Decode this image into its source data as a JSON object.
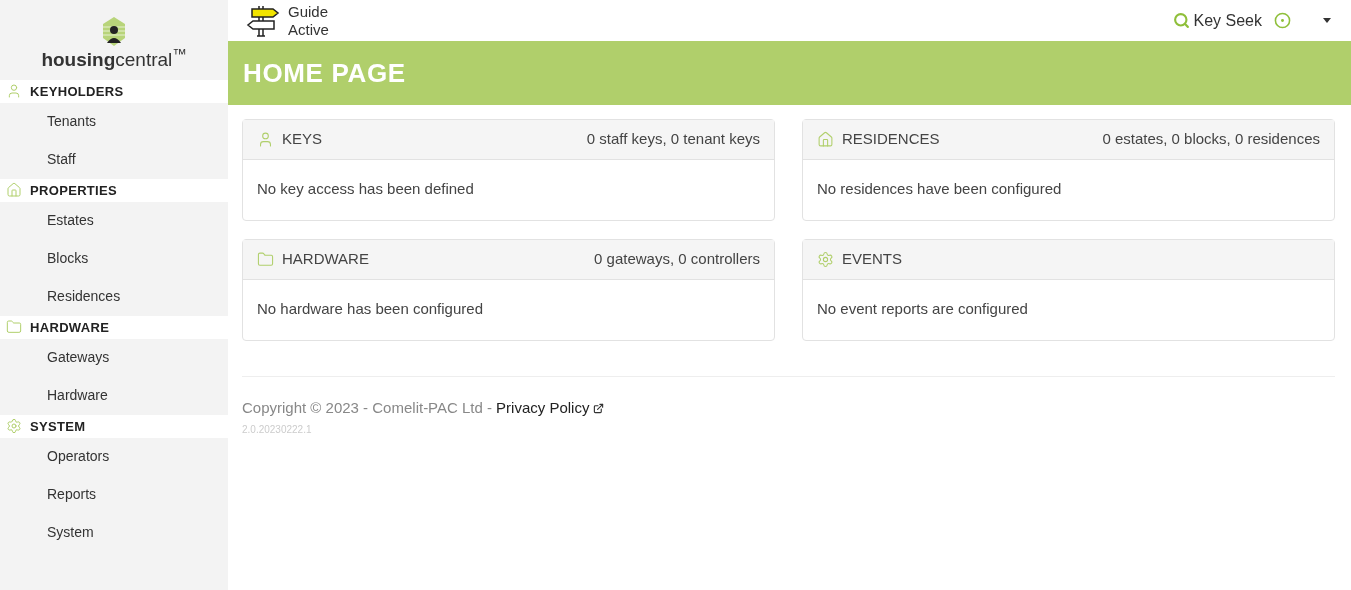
{
  "logo": {
    "text": "**housing**central$^{™}$"
  },
  "sidebar": {
    "sections": [
      {
        "title": "KEYHOLDERS",
        "kind": "keyholders",
        "items": [
          "Tenants",
          "Staff"
        ]
      },
      {
        "title": "PROPERTIES",
        "kind": "properties",
        "items": [
          "Estates",
          "Blocks",
          "Residences"
        ]
      },
      {
        "title": "HARDWARE",
        "kind": "hardware",
        "items": [
          "Gateways",
          "Hardware"
        ]
      },
      {
        "title": "SYSTEM",
        "kind": "system",
        "items": [
          "Operators",
          "Reports",
          "System"
        ]
      }
    ]
  },
  "guide": {
    "line_1": "Guide",
    "line_2": "Active"
  },
  "user_menu": {
    "label": "Key Seek"
  },
  "page_title": "HOME PAGE",
  "cards": [
    {
      "title": "KEYS",
      "kind": "keyholders",
      "summary": "0 staff keys, 0 tenant keys",
      "message": "No key access has been defined"
    },
    {
      "title": "RESIDENCES",
      "kind": "properties",
      "summary": "0 estates, 0 blocks, 0 residences",
      "message": "No residences have been configured"
    },
    {
      "title": "HARDWARE",
      "kind": "hardware",
      "summary": "0 gateways, 0 controllers",
      "message": "No hardware has been configured"
    },
    {
      "title": "EVENTS",
      "kind": "system",
      "message": "No event reports are configured"
    }
  ],
  "footer": {
    "copyright": "Copyright © 2023 - Comelit-PAC Ltd -",
    "link": "Privacy Policy",
    "version": "2.0.20230222.1"
  }
}
